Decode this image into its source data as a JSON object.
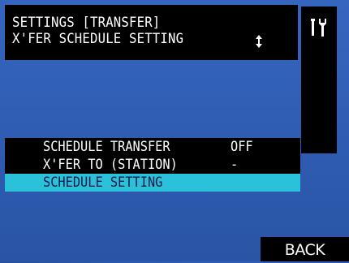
{
  "header": {
    "line1": "SETTINGS [TRANSFER]",
    "line2": "X'FER SCHEDULE SETTING",
    "scroll_icon": "up-down-arrows-icon"
  },
  "side_panel": {
    "icon": "tools-icon"
  },
  "menu": {
    "items": [
      {
        "label": "SCHEDULE TRANSFER",
        "value": "OFF",
        "selected": false
      },
      {
        "label": "X'FER TO (STATION)",
        "value": "-",
        "selected": false
      },
      {
        "label": "SCHEDULE SETTING",
        "value": "",
        "selected": true
      }
    ]
  },
  "footer": {
    "back_label": "BACK"
  },
  "colors": {
    "background": "#2f5db3",
    "panel": "#000000",
    "highlight": "#2bc1d9",
    "text": "#ffffff"
  }
}
